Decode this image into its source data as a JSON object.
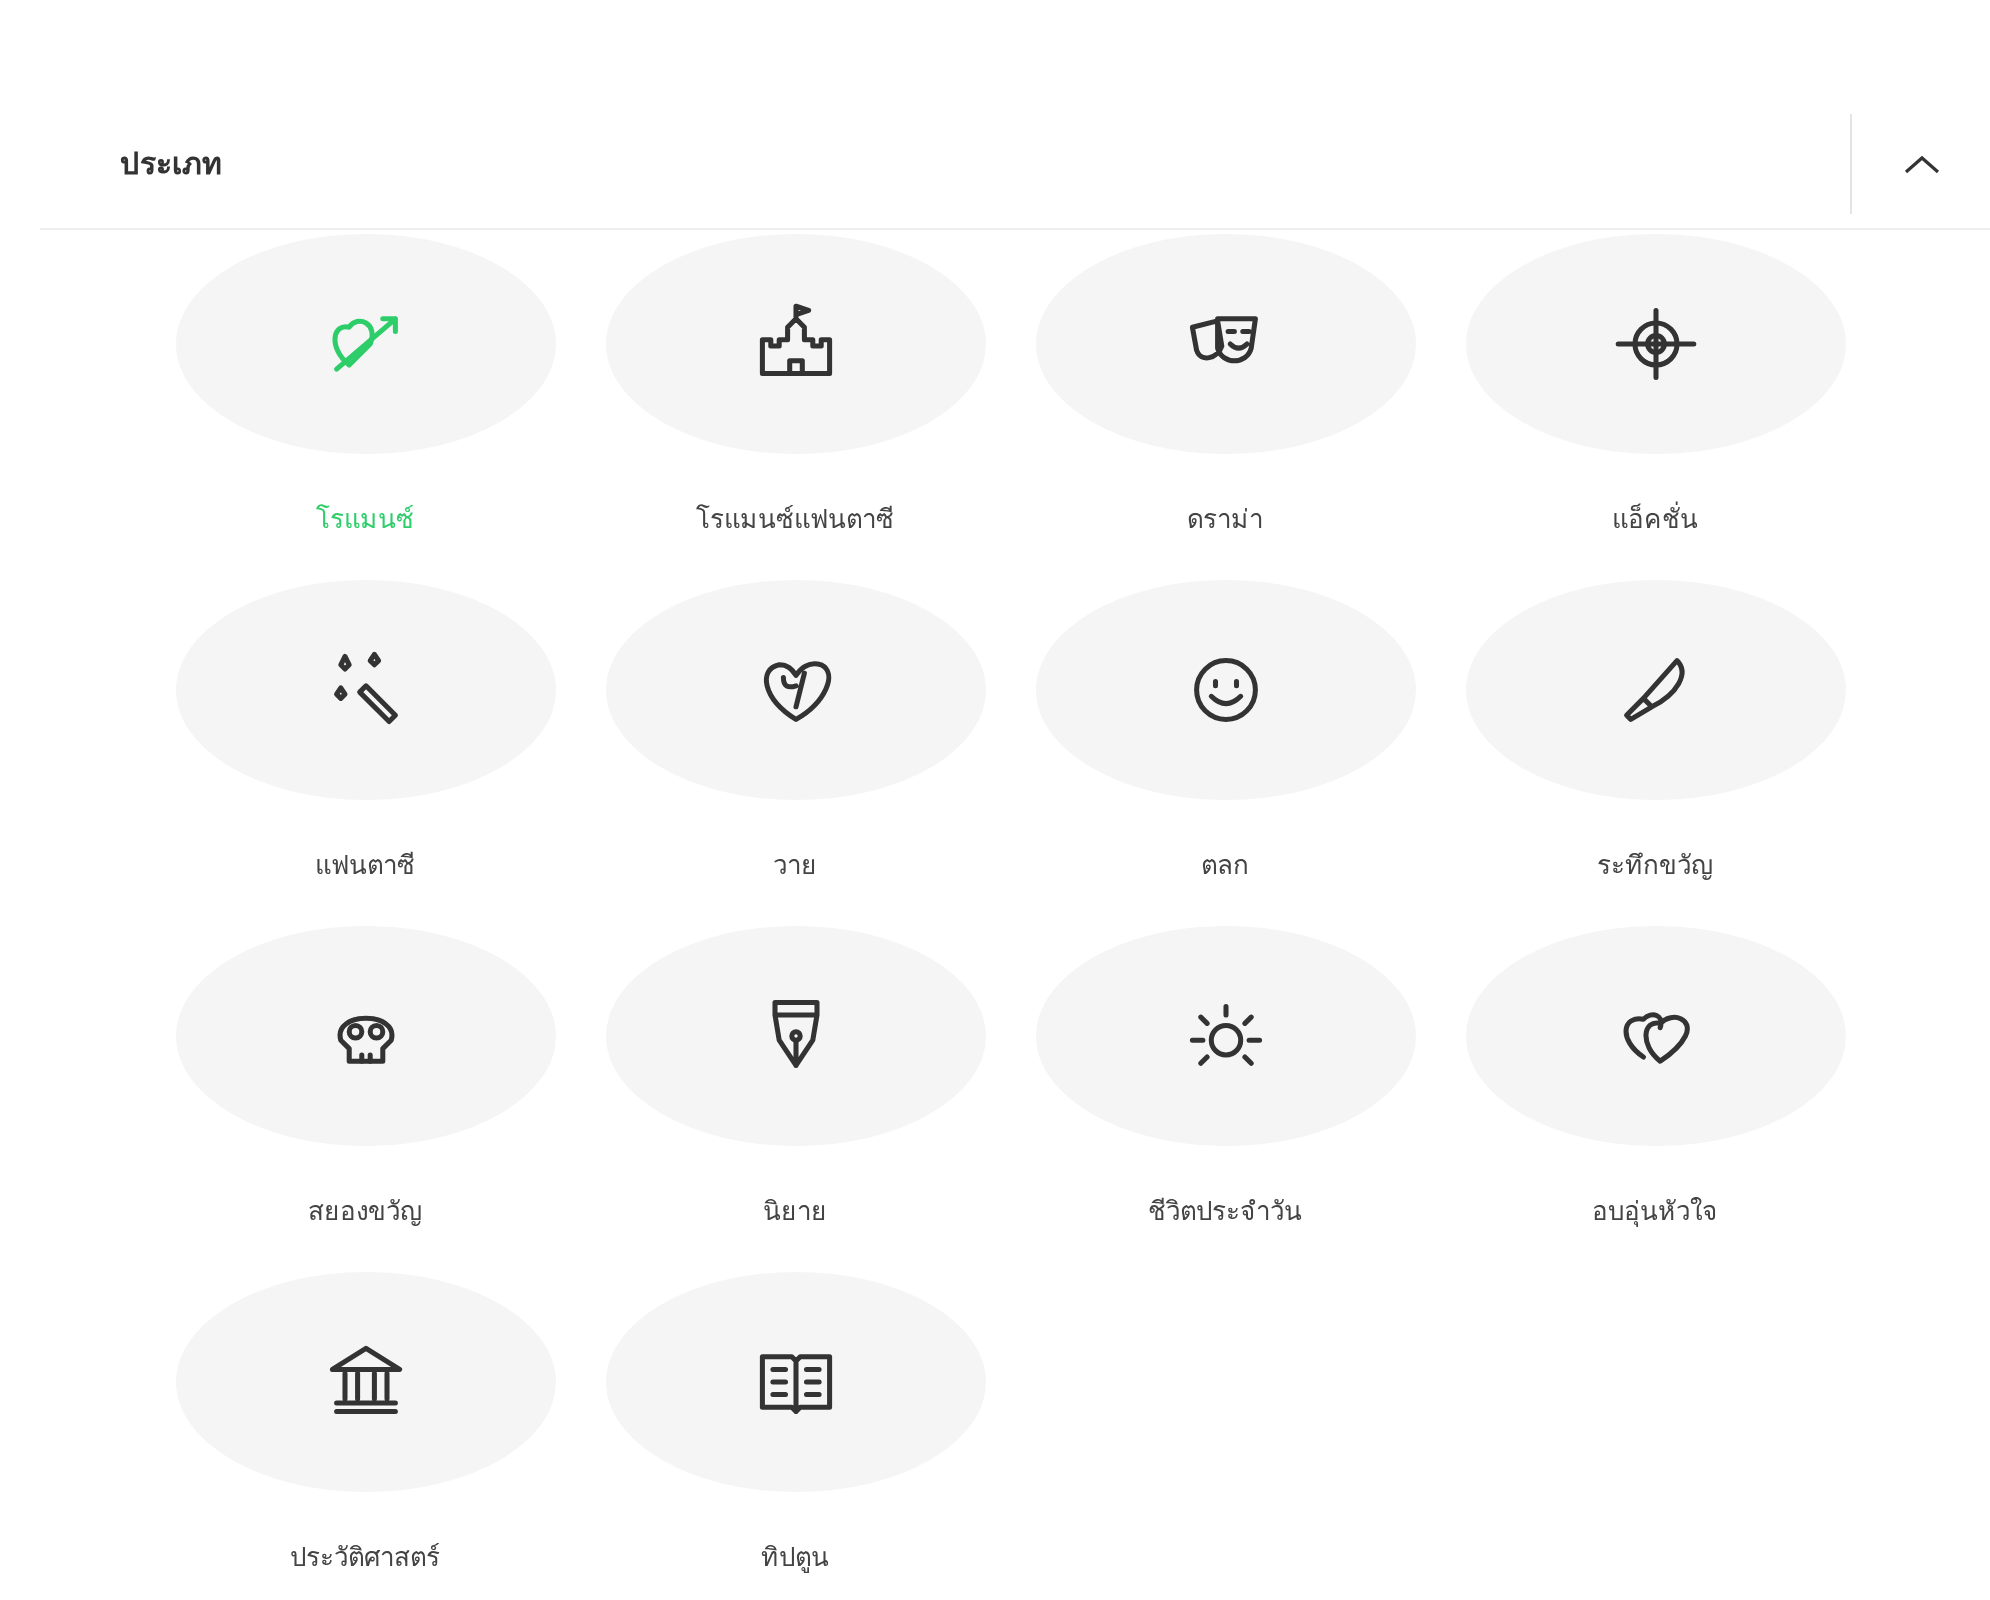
{
  "header": {
    "title": "ประเภท",
    "expanded": true
  },
  "genres": [
    {
      "label": "โรแมนซ์",
      "kind": "heart-arrow",
      "selected": true
    },
    {
      "label": "โรแมนซ์แฟนตาซี",
      "kind": "castle",
      "selected": false
    },
    {
      "label": "ดราม่า",
      "kind": "masks",
      "selected": false
    },
    {
      "label": "แอ็คชั่น",
      "kind": "target",
      "selected": false
    },
    {
      "label": "แฟนตาซี",
      "kind": "wand",
      "selected": false
    },
    {
      "label": "วาย",
      "kind": "y-heart",
      "selected": false
    },
    {
      "label": "ตลก",
      "kind": "smile",
      "selected": false
    },
    {
      "label": "ระทึกขวัญ",
      "kind": "knife",
      "selected": false
    },
    {
      "label": "สยองขวัญ",
      "kind": "skull",
      "selected": false
    },
    {
      "label": "นิยาย",
      "kind": "pen",
      "selected": false
    },
    {
      "label": "ชีวิตประจำวัน",
      "kind": "sun",
      "selected": false
    },
    {
      "label": "อบอุ่นหัวใจ",
      "kind": "hearts",
      "selected": false
    },
    {
      "label": "ประวัติศาสตร์",
      "kind": "museum",
      "selected": false
    },
    {
      "label": "ทิปตูน",
      "kind": "book",
      "selected": false
    }
  ]
}
